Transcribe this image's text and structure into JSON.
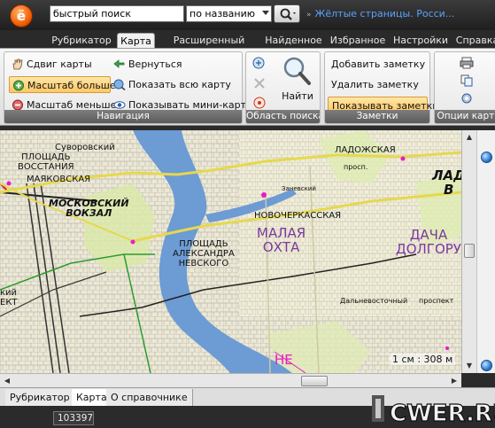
{
  "header": {
    "logo_letter": "ё",
    "search_value": "быстрый поиск",
    "search_mode": "по названию",
    "yellow_pages_link": "Жёлтые страницы. Росси..."
  },
  "ribbon_tabs": [
    "Рубрикатор",
    "Карта",
    "Расширенный поиск",
    "Найденное",
    "Избранное",
    "Настройки",
    "Справка"
  ],
  "ribbon_active_tab": "Карта",
  "groups": {
    "navigation": {
      "label": "Навигация",
      "buttons": {
        "pan": "Сдвиг карты",
        "back": "Вернуться",
        "zoom_in": "Масштаб больше",
        "show_all": "Показать всю карту",
        "zoom_out": "Масштаб меньше",
        "minimap": "Показывать мини-карту"
      }
    },
    "search_area": {
      "label": "Область поиска",
      "find_button": "Найти"
    },
    "notes": {
      "label": "Заметки",
      "add": "Добавить заметку",
      "remove": "Удалить заметку",
      "show": "Показывать заметки"
    },
    "card_options": {
      "label": "Опции карты"
    }
  },
  "map": {
    "labels": {
      "suvorovskiy": "Суворовский",
      "ploshchad_vosstaniya": "ПЛОЩАДЬ\nВОССТАНИЯ",
      "mayakovskaya": "МАЯКОВСКАЯ",
      "moskovskiy_vokzal": "МОСКОВСКИЙ\nВОКЗАЛ",
      "ploshchad_nevskogo": "ПЛОЩАДЬ\nАЛЕКСАНДРА\nНЕВСКОГО",
      "novocherkasskaya": "НОВОЧЕРКАССКАЯ",
      "malaya_okhta": "МАЛАЯ\nОХТА",
      "ladozhskaya": "ЛАДОЖСКАЯ",
      "prosp": "просп.",
      "zanevskiy": "Заневский",
      "dalnevostochny": "Дальневосточный",
      "prospekt": "проспект",
      "dacha": "ДАЧА\nДОЛГОРУ",
      "lad_b": "ЛАД\nВ",
      "left_cut": "кий\nЕКТ",
      "river_ne": "НЕ"
    },
    "scale": "1 см : 308 м"
  },
  "bottom_tabs": [
    "Рубрикатор",
    "Карта",
    "О справочнике"
  ],
  "bottom_active_tab": "Карта",
  "status": {
    "count": "103397"
  },
  "watermark": "CWER.RU",
  "colors": {
    "ribbon_highlight": "#ffc865",
    "link": "#5aa2ff",
    "map_water": "#6d9bd3",
    "map_land": "#e9e6d2",
    "metro_route": "#e6d84e"
  }
}
